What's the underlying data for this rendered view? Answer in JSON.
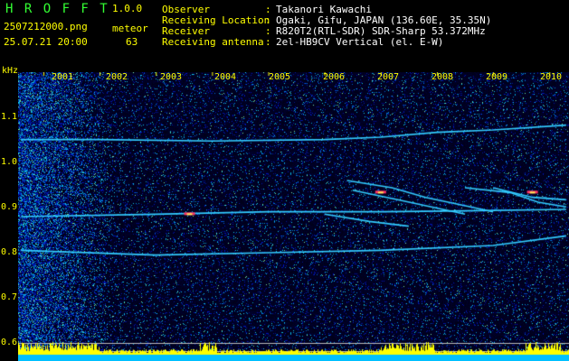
{
  "header": {
    "app_name": "H R O F F T",
    "version": "1.0.0",
    "filename": "2507212000.png",
    "timestamp": "25.07.21 20:00",
    "count_label": "meteor",
    "count_value": "63",
    "info": [
      {
        "key": "Observer",
        "sep": ":",
        "value": "Takanori Kawachi"
      },
      {
        "key": "Receiving Location",
        "sep": ":",
        "value": "Ogaki, Gifu, JAPAN (136.60E, 35.35N)"
      },
      {
        "key": "Receiver",
        "sep": ":",
        "value": "R820T2(RTL-SDR) SDR-Sharp 53.372MHz"
      },
      {
        "key": "Receiving antenna",
        "sep": ":",
        "value": "2el-HB9CV Vertical (el. E-W)"
      }
    ]
  },
  "colors": {
    "app_name": "#33ff33",
    "label": "#ffff00",
    "value": "#ffffff",
    "background": "#000000",
    "noise": "#0a1e8c",
    "trace": "#33ccff",
    "marker_band": "#ffff00",
    "baseline_band": "#00c0ff"
  },
  "chart_data": {
    "type": "heatmap",
    "y_unit": "kHz",
    "y_ticks": [
      "1.1",
      "1.0",
      "0.9",
      "0.8",
      "0.7",
      "0.6"
    ],
    "x_ticks": [
      "2001",
      "2002",
      "2003",
      "2004",
      "2005",
      "2006",
      "2007",
      "2008",
      "2009",
      "2010"
    ],
    "ylim": [
      0.58,
      1.18
    ],
    "xlim": [
      2000.55,
      2010.35
    ],
    "traces": [
      {
        "x": [
          2000.6,
          2002.0,
          2004.0,
          2006.0,
          2007.0,
          2008.0,
          2009.0,
          2010.3
        ],
        "y": [
          1.04,
          1.04,
          1.037,
          1.04,
          1.045,
          1.055,
          1.06,
          1.07
        ]
      },
      {
        "x": [
          2000.6,
          2003.0,
          2005.0,
          2007.0,
          2008.5,
          2010.3
        ],
        "y": [
          0.88,
          0.885,
          0.89,
          0.89,
          0.892,
          0.895
        ]
      },
      {
        "x": [
          2000.6,
          2003.0,
          2005.0,
          2007.0,
          2009.0,
          2010.3
        ],
        "y": [
          0.81,
          0.8,
          0.805,
          0.81,
          0.82,
          0.84
        ]
      },
      {
        "x": [
          2006.4,
          2007.2,
          2007.8,
          2008.6,
          2009.0
        ],
        "y": [
          0.955,
          0.94,
          0.92,
          0.9,
          0.89
        ]
      },
      {
        "x": [
          2006.5,
          2007.3,
          2007.9,
          2008.5
        ],
        "y": [
          0.935,
          0.915,
          0.9,
          0.885
        ]
      },
      {
        "x": [
          2006.0,
          2006.8,
          2007.5
        ],
        "y": [
          0.885,
          0.87,
          0.86
        ]
      },
      {
        "x": [
          2008.5,
          2009.3,
          2009.8,
          2010.3
        ],
        "y": [
          0.94,
          0.93,
          0.91,
          0.9
        ]
      },
      {
        "x": [
          2009.0,
          2009.7,
          2010.3
        ],
        "y": [
          0.94,
          0.92,
          0.915
        ]
      }
    ],
    "hotspots": [
      {
        "x": 2003.6,
        "y": 0.885
      },
      {
        "x": 2007.0,
        "y": 0.93
      },
      {
        "x": 2009.7,
        "y": 0.93
      }
    ],
    "reference_lines_khz": [
      0.618,
      0.6
    ]
  }
}
